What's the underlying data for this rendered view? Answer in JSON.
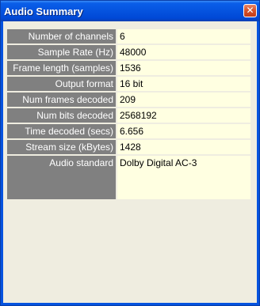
{
  "window": {
    "title": "Audio Summary",
    "close_glyph": "✕"
  },
  "summary": {
    "rows": [
      {
        "label": "Number of channels",
        "value": "6"
      },
      {
        "label": "Sample Rate (Hz)",
        "value": "48000"
      },
      {
        "label": "Frame length (samples)",
        "value": "1536"
      },
      {
        "label": "Output format",
        "value": "16 bit"
      },
      {
        "label": "Num frames decoded",
        "value": "209"
      },
      {
        "label": "Num bits decoded",
        "value": "2568192"
      },
      {
        "label": "Time decoded (secs)",
        "value": "6.656"
      },
      {
        "label": "Stream size (kBytes)",
        "value": "1428"
      },
      {
        "label": "Audio standard",
        "value": "Dolby Digital AC-3"
      }
    ]
  }
}
